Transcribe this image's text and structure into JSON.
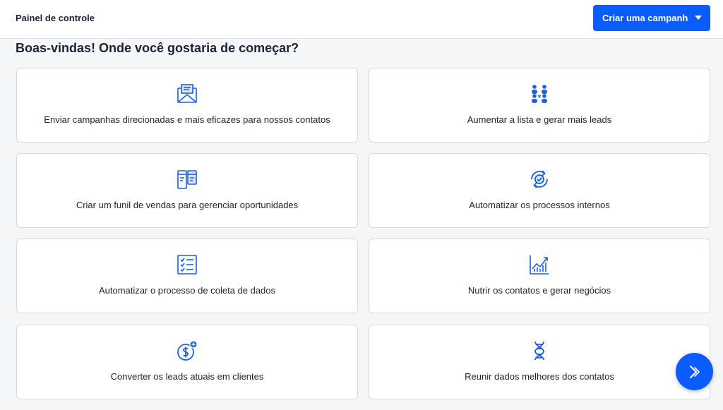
{
  "header": {
    "title": "Painel de controle",
    "create_button_label": "Criar uma campanha"
  },
  "welcome_title": "Boas-vindas! Onde você gostaria de começar?",
  "cards": [
    {
      "label": "Enviar campanhas direcionadas e mais eficazes para nossos contatos",
      "icon": "envelope-icon"
    },
    {
      "label": "Aumentar a lista e gerar mais leads",
      "icon": "people-group-icon"
    },
    {
      "label": "Criar um funil de vendas para gerenciar oportunidades",
      "icon": "pipeline-board-icon"
    },
    {
      "label": "Automatizar os processos internos",
      "icon": "automation-cycle-icon"
    },
    {
      "label": "Automatizar o processo de coleta de dados",
      "icon": "checklist-icon"
    },
    {
      "label": "Nutrir os contatos e gerar negócios",
      "icon": "growth-chart-icon"
    },
    {
      "label": "Converter os leads atuais em clientes",
      "icon": "dollar-plus-icon"
    },
    {
      "label": "Reunir dados melhores dos contatos",
      "icon": "dna-icon"
    }
  ],
  "colors": {
    "accent": "#0b5cff",
    "icon_blue": "#1f5fd6",
    "background": "#f5f6f8",
    "card_border": "#d4d9e2"
  },
  "fab_icon": "chevron-right-icon"
}
